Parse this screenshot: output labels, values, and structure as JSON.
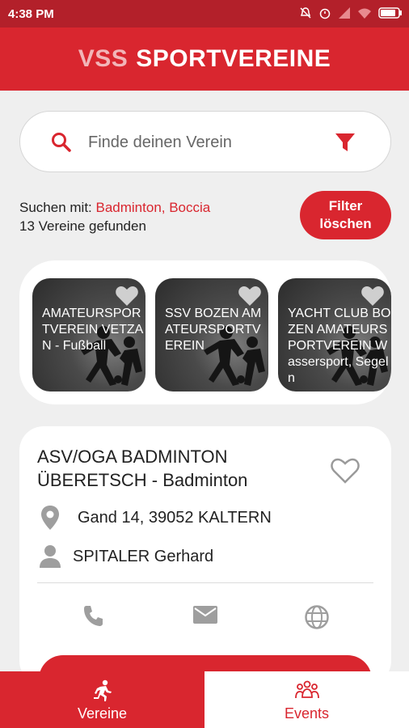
{
  "status_bar": {
    "time": "4:38 PM"
  },
  "app_title": {
    "part1": "VSS",
    "part2": "SPORTVEREINE"
  },
  "search": {
    "placeholder": "Finde deinen Verein"
  },
  "search_info": {
    "prefix": "Suchen mit: ",
    "filters": "Badminton, Boccia",
    "count_text": "13 Vereine gefunden"
  },
  "filter_button": {
    "line1": "Filter",
    "line2": "löschen"
  },
  "carousel": [
    {
      "name": "AMATEURSPORTVEREIN VETZAN - Fußball"
    },
    {
      "name": "SSV BOZEN AMATEURSPORTVEREIN"
    },
    {
      "name": "YACHT CLUB BOZEN AMATEURSPORTVEREIN Wassersport, Segeln"
    }
  ],
  "club": {
    "title": "ASV/OGA BADMINTON ÜBERETSCH - Badminton",
    "address": "Gand 14, 39052  KALTERN",
    "contact": "SPITALER Gerhard"
  },
  "bottom_nav": {
    "vereine": "Vereine",
    "events": "Events"
  },
  "colors": {
    "primary": "#d9262f",
    "status_bar": "#b3202a",
    "background": "#efefef"
  }
}
